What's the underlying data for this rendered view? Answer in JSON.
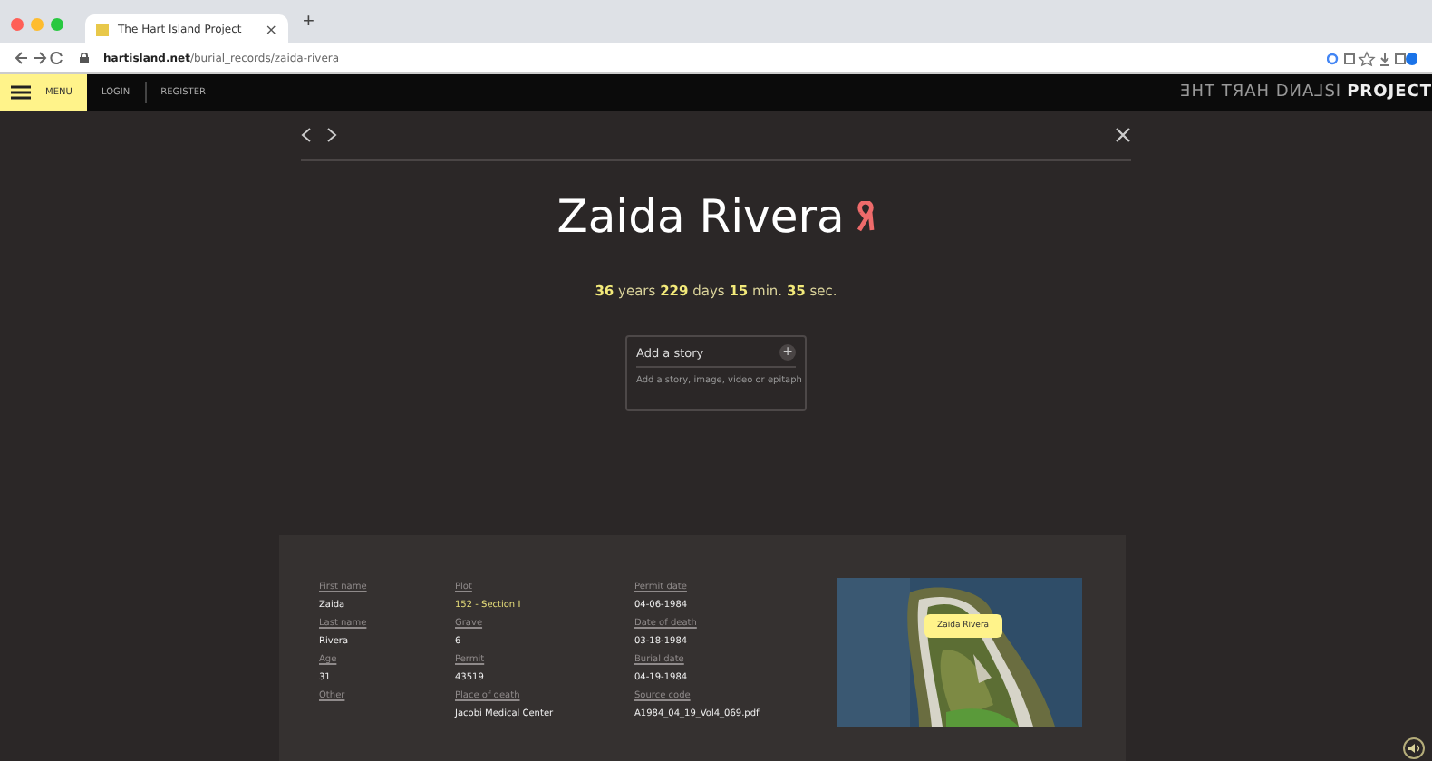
{
  "browser": {
    "tab_title": "The Hart Island Project",
    "url": "**hartisland.net**/burial_records/zaida-rivera",
    "new_tab": "+",
    "tab_close": "×"
  },
  "nav": {
    "menu": "MENU",
    "links": [
      "LOGIN",
      "REGISTER"
    ],
    "logo_mirrored": "ƎHT TЯAH DИA⅃SI",
    "logo": "PROJECT"
  },
  "record": {
    "name": "Zaida Rivera",
    "duration": "**36** years **229** days **15** min. **35** sec.",
    "story": {
      "title": "Add a story",
      "add": "+",
      "hint": "Add a story, image, video or epitaph"
    }
  },
  "fields": [
    [
      {
        "label": "First name",
        "value": "Zaida",
        "link": false
      },
      {
        "label": "Last name",
        "value": "Rivera",
        "link": false
      },
      {
        "label": "Age",
        "value": "31",
        "link": false
      },
      {
        "label": "Other"
      }
    ],
    [
      {
        "label": "Plot",
        "value": "152 - Section I",
        "link": true
      },
      {
        "label": "Grave",
        "value": "6",
        "link": false
      },
      {
        "label": "Permit",
        "value": "43519",
        "link": false
      },
      {
        "label": "Place of death",
        "value": "Jacobi Medical Center",
        "link": false
      }
    ],
    [
      {
        "label": "Permit date",
        "value": "04-06-1984",
        "link": false
      },
      {
        "label": "Date of death",
        "value": "03-18-1984",
        "link": false
      },
      {
        "label": "Burial date",
        "value": "04-19-1984",
        "link": false
      },
      {
        "label": "Source code",
        "value": "A1984_04_19_Vol4_069.pdf",
        "link": false
      }
    ]
  ],
  "map": {
    "marker": "Zaida Rivera"
  }
}
